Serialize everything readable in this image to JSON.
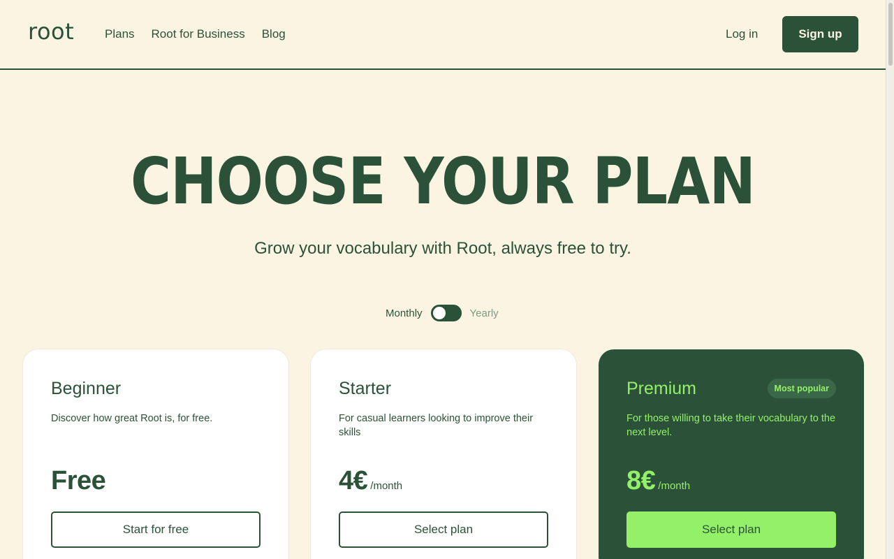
{
  "header": {
    "logo": "root",
    "nav": [
      "Plans",
      "Root for Business",
      "Blog"
    ],
    "login_label": "Log in",
    "signup_label": "Sign up"
  },
  "hero": {
    "title": "CHOOSE YOUR PLAN",
    "subtitle": "Grow your vocabulary with Root, always free to try."
  },
  "billing": {
    "monthly_label": "Monthly",
    "yearly_label": "Yearly",
    "selected": "Monthly"
  },
  "plans": [
    {
      "name": "Beginner",
      "description": "Discover how great Root is, for free.",
      "price": "Free",
      "unit": "",
      "button": "Start for free"
    },
    {
      "name": "Starter",
      "description": "For casual learners looking to improve their skills",
      "price": "4€",
      "unit": "/month",
      "button": "Select plan"
    },
    {
      "name": "Premium",
      "badge": "Most popular",
      "description": "For those willing to take their vocabulary to the next level.",
      "price": "8€",
      "unit": "/month",
      "button": "Select plan"
    }
  ],
  "colors": {
    "background": "#FBF4E3",
    "primary": "#2B5239",
    "accent": "#93F068",
    "card": "#FFFFFF"
  }
}
